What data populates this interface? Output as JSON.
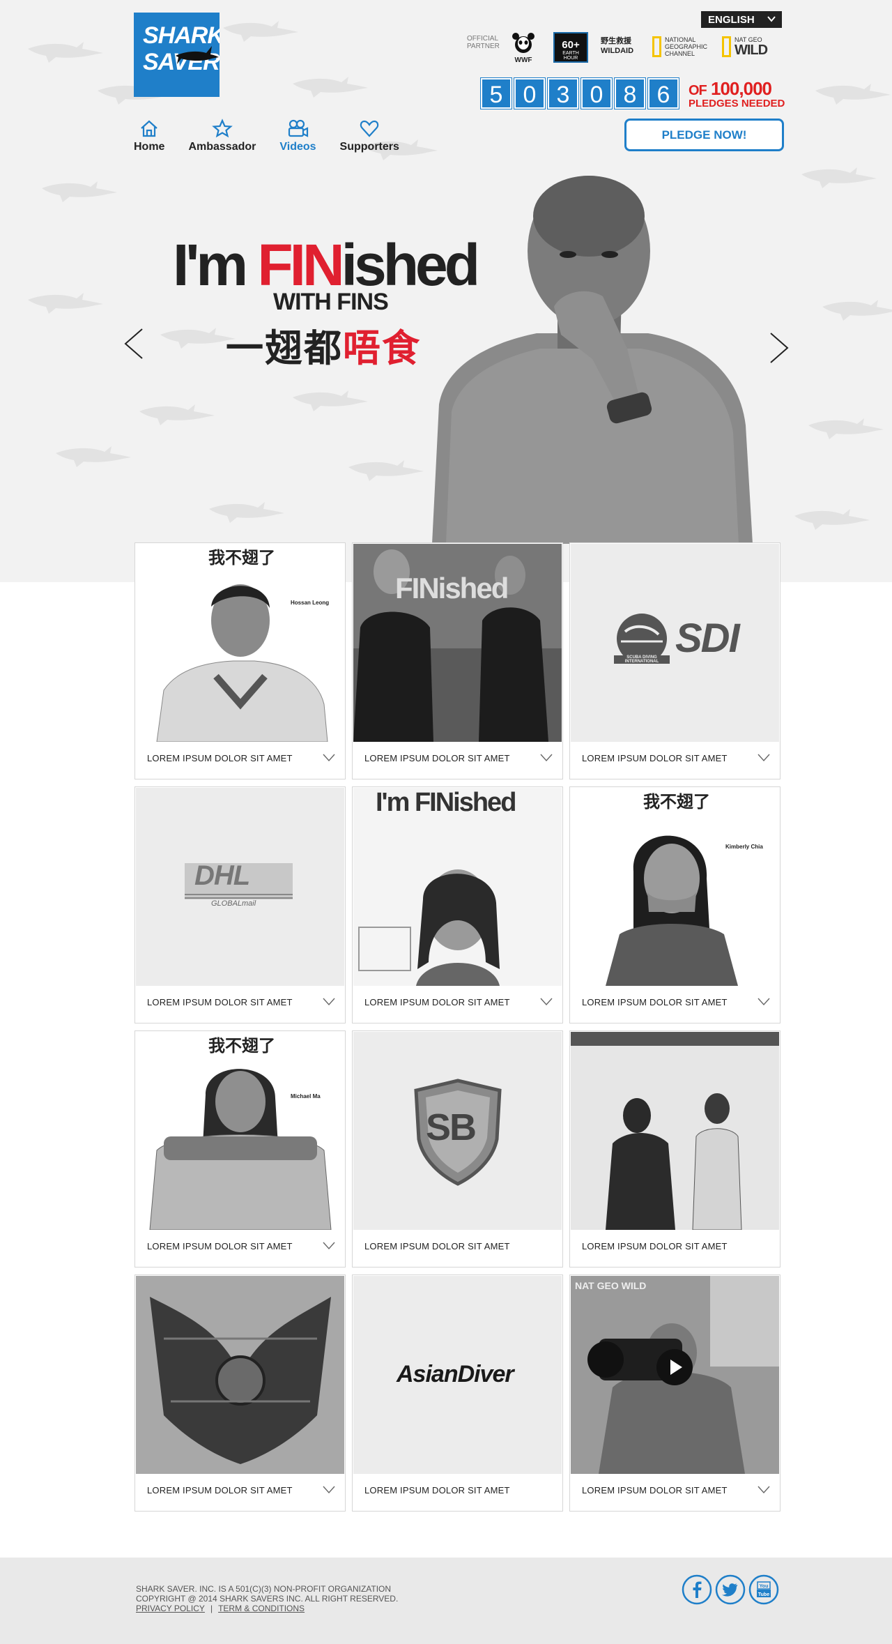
{
  "header": {
    "logo_line1": "SHARK",
    "logo_line2": "SAVERS",
    "language": "ENGLISH",
    "partners": {
      "official": "OFFICIAL PARTNER",
      "wwf": "WWF",
      "earth_hour": "60+",
      "earth_hour_sub": "EARTH HOUR",
      "wildaid_cn": "野生救援",
      "wildaid": "WILDAID",
      "natgeo": "NATIONAL GEOGRAPHIC CHANNEL",
      "natgeo_wild_top": "NAT GEO",
      "natgeo_wild": "WILD"
    },
    "counter_digits": [
      "5",
      "0",
      "3",
      "0",
      "8",
      "6"
    ],
    "of_label": "OF",
    "goal": "100,000",
    "pledges_needed": "PLEDGES NEEDED",
    "pledge_button": "PLEDGE NOW!"
  },
  "nav": {
    "items": [
      {
        "label": "Home",
        "icon": "home-icon"
      },
      {
        "label": "Ambassador",
        "icon": "star-icon"
      },
      {
        "label": "Videos",
        "icon": "video-icon",
        "active": true
      },
      {
        "label": "Supporters",
        "icon": "heart-icon"
      }
    ]
  },
  "hero": {
    "line1_a": "I'm ",
    "line1_b": "FIN",
    "line1_c": "ished",
    "line2": "WITH FINS",
    "line3_a": "一翅都",
    "line3_b": "唔食"
  },
  "cards": [
    {
      "caption": "LOREM IPSUM DOLOR SIT AMET",
      "image": "portrait-hossan-leong",
      "thumb_top": "我不翅了",
      "name": "Hossan Leong",
      "expandable": true
    },
    {
      "caption": "LOREM IPSUM DOLOR SIT AMET",
      "image": "event-photo-microphone",
      "thumb_text": "FINished",
      "expandable": true
    },
    {
      "caption": "LOREM IPSUM DOLOR SIT AMET",
      "image": "sdi-logo",
      "logo_small": "SCUBA DIVING INTERNATIONAL",
      "logo_text": "SDI",
      "expandable": true
    },
    {
      "caption": "LOREM IPSUM DOLOR SIT AMET",
      "image": "dhl-logo",
      "logo_text": "DHL",
      "logo_sub": "GLOBALmail",
      "expandable": true
    },
    {
      "caption": "LOREM IPSUM DOLOR SIT AMET",
      "image": "poster-gem",
      "thumb_text": "I'm FINished",
      "expandable": true
    },
    {
      "caption": "LOREM IPSUM DOLOR SIT AMET",
      "image": "portrait-kimberly-chia",
      "thumb_top": "我不翅了",
      "name": "Kimberly Chia",
      "expandable": true
    },
    {
      "caption": "LOREM IPSUM DOLOR SIT AMET",
      "image": "portrait-michael-ma",
      "thumb_top": "我不翅了",
      "name": "Michael Ma",
      "expandable": true
    },
    {
      "caption": "LOREM IPSUM DOLOR SIT AMET",
      "image": "sb-shield-logo",
      "logo_text": "SB",
      "expandable": false
    },
    {
      "caption": "LOREM IPSUM DOLOR SIT AMET",
      "image": "event-photo-girls",
      "expandable": false
    },
    {
      "caption": "LOREM IPSUM DOLOR SIT AMET",
      "image": "illustration-shark",
      "expandable": true
    },
    {
      "caption": "LOREM IPSUM DOLOR SIT AMET",
      "image": "asiandiver-logo",
      "logo_text": "AsianDiver",
      "expandable": false
    },
    {
      "caption": "LOREM IPSUM DOLOR SIT AMET",
      "image": "video-cameraman",
      "thumb_text": "NAT GEO WILD",
      "video": true,
      "expandable": true
    }
  ],
  "footer": {
    "line1": "SHARK SAVER. INC. IS A 501(C)(3) NON-PROFIT ORGANIZATION",
    "line2": "COPYRIGHT @ 2014 SHARK SAVERS INC. ALL RIGHT RESERVED.",
    "privacy": "PRIVACY POLICY",
    "separator": "|",
    "terms": "TERM & CONDITIONS",
    "social": [
      "facebook-icon",
      "twitter-icon",
      "youtube-icon"
    ],
    "youtube_you": "You",
    "youtube_tube": "Tube"
  },
  "colors": {
    "brand_blue": "#1f7fc9",
    "accent_red": "#e02030"
  }
}
